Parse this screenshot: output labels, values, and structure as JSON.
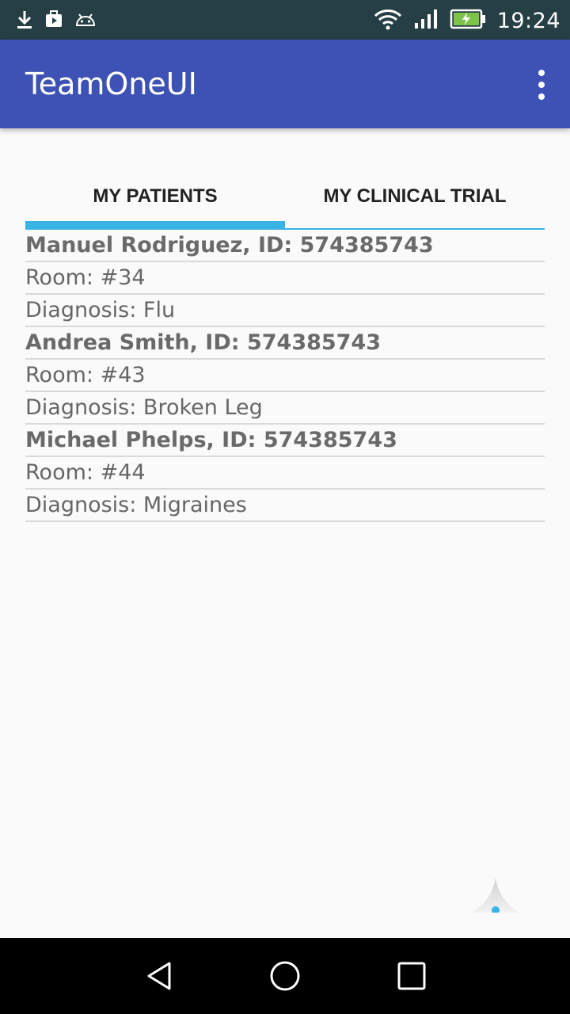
{
  "status_bar": {
    "time": "19:24",
    "left_icons": [
      "download-icon",
      "media-briefcase-icon",
      "android-icon"
    ],
    "right_icons": [
      "wifi-icon",
      "cell-signal-icon",
      "battery-charging-icon"
    ]
  },
  "app_bar": {
    "title": "TeamOneUI",
    "menu_icon": "overflow-menu-icon"
  },
  "tabs": [
    {
      "label": "MY PATIENTS",
      "selected": true
    },
    {
      "label": "MY CLINICAL TRIAL",
      "selected": false
    }
  ],
  "patients": [
    {
      "header": "Manuel Rodriguez, ID: 574385743",
      "room": "Room: #34",
      "diagnosis": "Diagnosis: Flu"
    },
    {
      "header": "Andrea Smith, ID: 574385743",
      "room": "Room: #43",
      "diagnosis": "Diagnosis: Broken Leg"
    },
    {
      "header": "Michael Phelps, ID: 574385743",
      "room": "Room: #44",
      "diagnosis": "Diagnosis: Migraines"
    }
  ],
  "colors": {
    "status_bar": "#263f45",
    "app_bar": "#3e51b5",
    "accent": "#37b3e4",
    "background": "#fafafa"
  },
  "nav_bar": [
    "back-icon",
    "home-icon",
    "recents-icon"
  ]
}
